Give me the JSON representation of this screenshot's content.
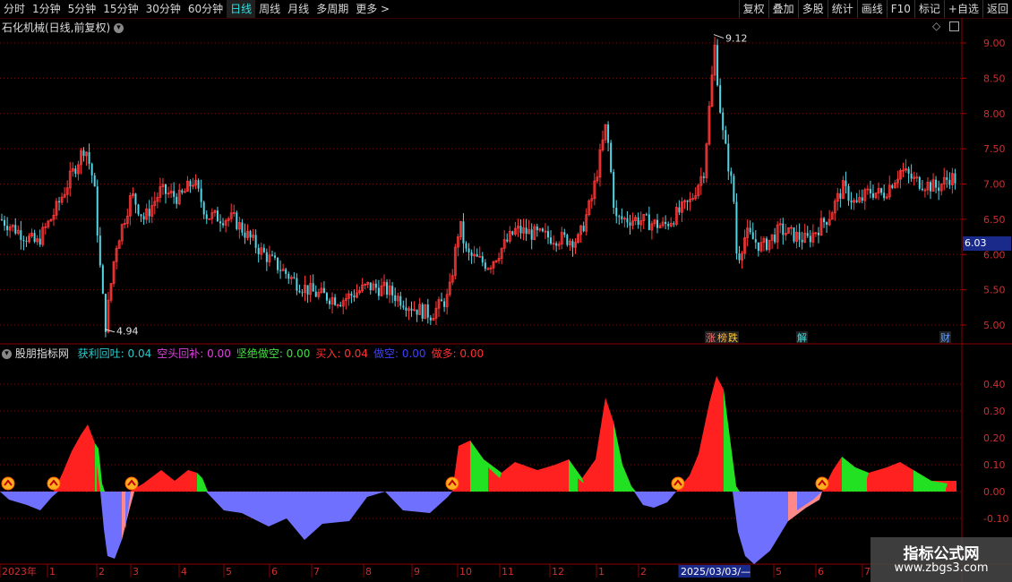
{
  "toolbar": {
    "periods": [
      "分时",
      "1分钟",
      "5分钟",
      "15分钟",
      "30分钟",
      "60分钟",
      "日线",
      "周线",
      "月线",
      "多周期",
      "更多 >"
    ],
    "active_period": "日线",
    "actions": [
      "复权",
      "叠加",
      "多股",
      "统计",
      "画线",
      "F10",
      "标记",
      "+自选",
      "返回"
    ]
  },
  "main_pane": {
    "title": "石化机械(日线,前复权)",
    "high_label": "9.12",
    "low_label": "4.94",
    "last_price": "6.03",
    "y_ticks": [
      "9.00",
      "8.50",
      "8.00",
      "7.50",
      "7.00",
      "6.50",
      "6.00",
      "5.50",
      "5.00"
    ],
    "event_tags": [
      "涨",
      "榜",
      "跌",
      "解",
      "财"
    ]
  },
  "indicator_pane": {
    "name": "股朋指标网",
    "lines": [
      {
        "label": "获利回吐:",
        "value": "0.04",
        "color": "#2ec8c8"
      },
      {
        "label": "空头回补:",
        "value": "0.00",
        "color": "#e040e0"
      },
      {
        "label": "坚绝做空:",
        "value": "0.00",
        "color": "#40e040"
      },
      {
        "label": "买入:",
        "value": "0.04",
        "color": "#ff3030"
      },
      {
        "label": "做空:",
        "value": "0.00",
        "color": "#4040ff"
      },
      {
        "label": "做多:",
        "value": "0.00",
        "color": "#ff3030"
      }
    ],
    "y_ticks": [
      "0.40",
      "0.30",
      "0.20",
      "0.10",
      "0.00",
      "-0.10"
    ]
  },
  "x_axis": {
    "labels": [
      "2023年",
      "1",
      "2",
      "3",
      "4",
      "5",
      "6",
      "7",
      "8",
      "9",
      "10",
      "11",
      "12",
      "1",
      "2",
      "2025/03/03/—",
      "5",
      "6",
      "7"
    ]
  },
  "watermark": {
    "line1": "指标公式网",
    "line2": "www.zbgs3.com"
  },
  "chart_data": {
    "type": "bar",
    "price_range": [
      4.94,
      9.12
    ],
    "last_close": 6.03,
    "indicator_range": [
      -0.15,
      0.45
    ],
    "colors": {
      "up": "#ff3838",
      "down": "#54d6e6",
      "buy": "#ff2020",
      "profit_take": "#22e022",
      "short": "#7070ff",
      "cover": "#ff8888"
    }
  }
}
